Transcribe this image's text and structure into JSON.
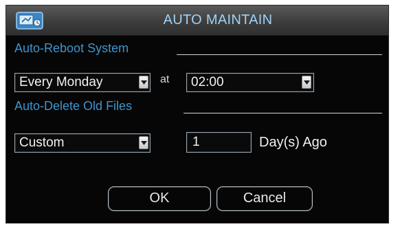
{
  "window": {
    "title": "AUTO MAINTAIN",
    "icon": "maintain-tools-icon"
  },
  "reboot": {
    "section_label": "Auto-Reboot System",
    "day_value": "Every Monday",
    "at_label": "at",
    "time_value": "02:00"
  },
  "delete": {
    "section_label": "Auto-Delete Old Files",
    "mode_value": "Custom",
    "days_value": "1",
    "days_suffix": "Day(s) Ago"
  },
  "buttons": {
    "ok_label": "OK",
    "cancel_label": "Cancel"
  },
  "colors": {
    "title_text": "#9fd2f5",
    "section_label": "#3f95cf",
    "dialog_background": "#060606"
  }
}
